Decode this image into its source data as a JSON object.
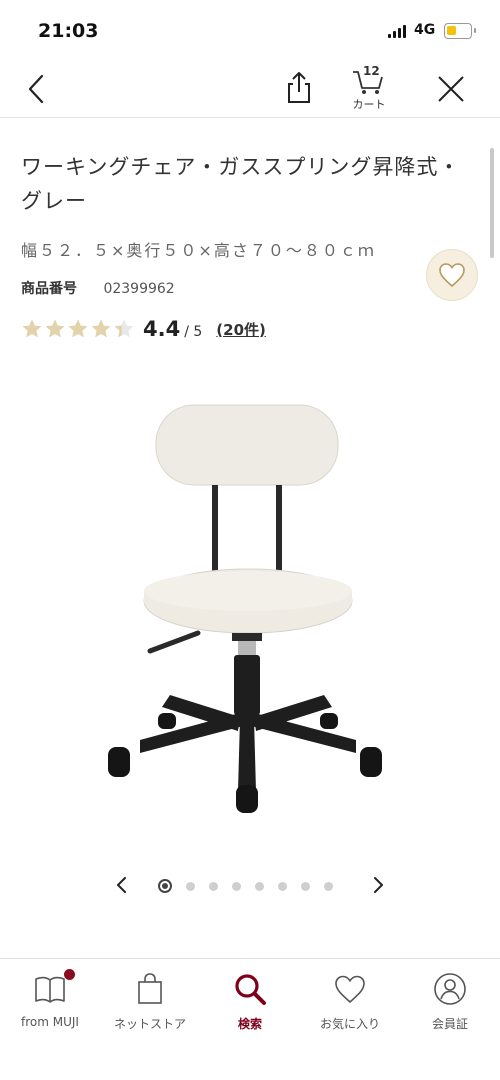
{
  "status_bar": {
    "time": "21:03",
    "network": "4G",
    "battery_level": 0.4,
    "battery_color": "#f4c20d"
  },
  "navbar": {
    "back_icon": "chevron-left-icon",
    "share_icon": "share-icon",
    "cart_count": "12",
    "cart_label": "カート",
    "close_icon": "close-icon"
  },
  "product": {
    "title": "ワーキングチェア・ガススプリング昇降式・グレー",
    "size": "幅５２．５×奥行５０×高さ７０～８０ｃｍ",
    "code_label": "商品番号",
    "code_value": "02399962",
    "rating": 4.4,
    "rating_display": "4.4",
    "rating_max": "/ 5",
    "review_count": "(20件)",
    "star_color": "#e3d3ad",
    "favorite_icon": "heart-icon",
    "image_icon": "office-chair-image"
  },
  "carousel": {
    "total": 8,
    "active_index": 0
  },
  "tabbar": {
    "accent": "#7f0019",
    "items": [
      {
        "label": "from MUJI",
        "icon": "book-icon"
      },
      {
        "label": "ネットストア",
        "icon": "shopping-bag-icon"
      },
      {
        "label": "検索",
        "icon": "search-icon"
      },
      {
        "label": "お気に入り",
        "icon": "heart-icon"
      },
      {
        "label": "会員証",
        "icon": "member-card-icon"
      }
    ]
  }
}
